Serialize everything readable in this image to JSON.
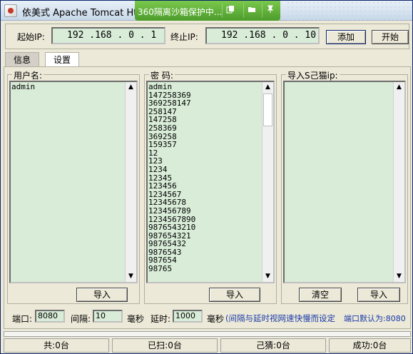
{
  "window": {
    "title": "依美式 Apache Tomcat Http",
    "sandbox_text": "360隔离沙箱保护中...",
    "sandbox_buttons": [
      "copy-icon",
      "folder-icon",
      "pin-icon"
    ]
  },
  "ip_row": {
    "start_label": "起始IP:",
    "start_ip": "192 .168 .  0  .  1",
    "end_label": "终止IP:",
    "end_ip": "192 .168 .  0  . 10",
    "add_button": "添加",
    "start_button": "开始"
  },
  "tabs": [
    {
      "label": "信息",
      "active": false
    },
    {
      "label": "设置",
      "active": true
    }
  ],
  "username_group": {
    "title": "用户名:",
    "items": [
      "admin"
    ],
    "import_button": "导入"
  },
  "password_group": {
    "title": "密 码:",
    "items": [
      "admin",
      "147258369",
      "369258147",
      "258147",
      "147258",
      "258369",
      "369258",
      "159357",
      "12",
      "123",
      "1234",
      "12345",
      "123456",
      "1234567",
      "12345678",
      "123456789",
      "1234567890",
      "9876543210",
      "987654321",
      "98765432",
      "9876543",
      "987654",
      "98765"
    ],
    "import_button": "导入"
  },
  "ip_group": {
    "title": "导入S己猫ip:",
    "items": [],
    "clear_button": "清空",
    "import_button": "导入"
  },
  "settings_row": {
    "port_label": "端口:",
    "port_value": "8080",
    "interval_label": "间隔:",
    "interval_value": "10",
    "ms_label1": "毫秒",
    "delay_label": "延时:",
    "delay_value": "1000",
    "ms_label2": "毫秒",
    "note": "(间隔与延时视网速快慢而设定",
    "default_port_note": "端口默认为:8080"
  },
  "status": {
    "total": "共:0台",
    "scanned": "已扫:0台",
    "guessed": "己猜:0台",
    "success": "成功:0台"
  },
  "colors": {
    "list_bg": "#d8ecd8",
    "sandbox_green": "#5cae3a",
    "note_blue": "#1a3aa8"
  }
}
